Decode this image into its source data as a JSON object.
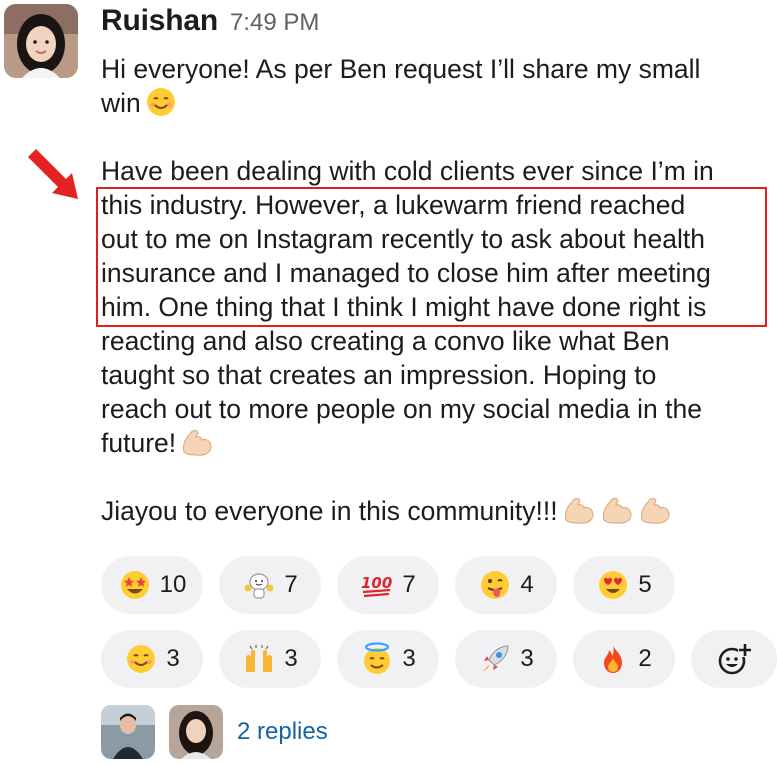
{
  "message": {
    "author": "Ruishan",
    "timestamp": "7:49 PM",
    "paragraph1": [
      "Hi everyone! As per Ben request I’ll share my small",
      "win"
    ],
    "paragraph2": [
      "Have been dealing with cold clients ever since I’m in",
      "this industry. However, a lukewarm friend reached",
      "out to me on Instagram recently to ask about health",
      "insurance and I managed to close him after meeting",
      "him. One thing that I think I might have done right is",
      "reacting and also creating a convo like what Ben",
      "taught so that creates an impression. Hoping to",
      "reach out to more people on my social media in the",
      "future!"
    ],
    "paragraph3": "Jiayou to everyone in this community!!!"
  },
  "reactions": [
    {
      "icon": "star-struck-icon",
      "count": "10"
    },
    {
      "icon": "cheering-character-icon",
      "count": "7"
    },
    {
      "icon": "hundred-points-icon",
      "count": "7"
    },
    {
      "icon": "tongue-out-face-icon",
      "count": "4"
    },
    {
      "icon": "heart-eyes-face-icon",
      "count": "5"
    },
    {
      "icon": "smiling-face-icon",
      "count": "3"
    },
    {
      "icon": "raised-hands-icon",
      "count": "3"
    },
    {
      "icon": "halo-face-icon",
      "count": "3"
    },
    {
      "icon": "rocket-icon",
      "count": "3"
    },
    {
      "icon": "fire-icon",
      "count": "2"
    }
  ],
  "thread": {
    "replies_label": "2 replies"
  },
  "colors": {
    "highlight": "#e02020",
    "link": "#1264a3",
    "reaction_bg": "#f1f1f3",
    "timestamp": "#616061"
  }
}
